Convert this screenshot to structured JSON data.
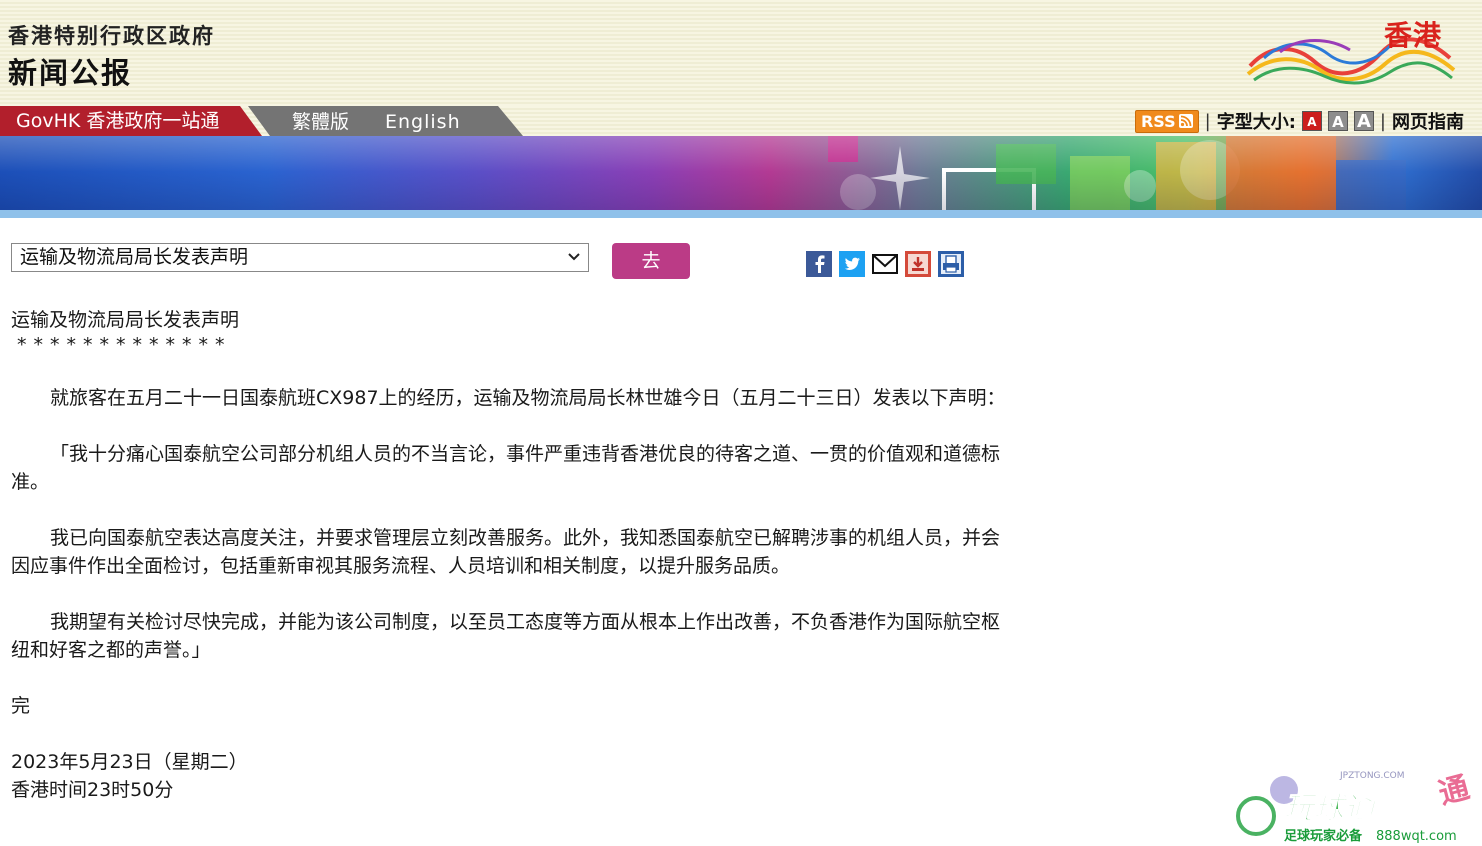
{
  "header": {
    "govt_name": "香港特别行政区政府",
    "bulletin_title": "新闻公报",
    "brand_text": "香港"
  },
  "nav": {
    "govhk": "GovHK 香港政府一站通",
    "traditional": "繁體版",
    "english": "English",
    "rss": "RSS",
    "font_size_label": "字型大小:",
    "font_small": "A",
    "font_medium": "A",
    "font_large": "A",
    "guide": "网页指南",
    "separator": "|"
  },
  "selector": {
    "selected": "运输及物流局局长发表声明",
    "go_label": "去"
  },
  "share_icons": [
    "facebook-icon",
    "twitter-icon",
    "email-icon",
    "download-icon",
    "print-icon"
  ],
  "article": {
    "title": "运输及物流局局长发表声明",
    "stars": "*************",
    "paragraphs": [
      "就旅客在五月二十一日国泰航班CX987上的经历，运输及物流局局长林世雄今日（五月二十三日）发表以下声明：",
      "「我十分痛心国泰航空公司部分机组人员的不当言论，事件严重违背香港优良的待客之道、一贯的价值观和道德标准。",
      "我已向国泰航空表达高度关注，并要求管理层立刻改善服务。此外，我知悉国泰航空已解聘涉事的机组人员，并会因应事件作出全面检讨，包括重新审视其服务流程、人员培训和相关制度，以提升服务品质。",
      "我期望有关检讨尽快完成，并能为该公司制度，以至员工态度等方面从根本上作出改善，不负香港作为国际航空枢纽和好客之都的声誉。」"
    ],
    "end_mark": "完",
    "date": "2023年5月23日（星期二）",
    "time": "香港时间23时50分"
  },
  "watermark": {
    "site": "JPZTONG.COM",
    "brand": "玩球通",
    "tagline": "足球玩家必备",
    "domain": "888wqt.com"
  },
  "colors": {
    "govhk_red": "#b21f2c",
    "lang_grey": "#747474",
    "go_button": "#bb3b86",
    "brand_red": "#d9231d"
  }
}
